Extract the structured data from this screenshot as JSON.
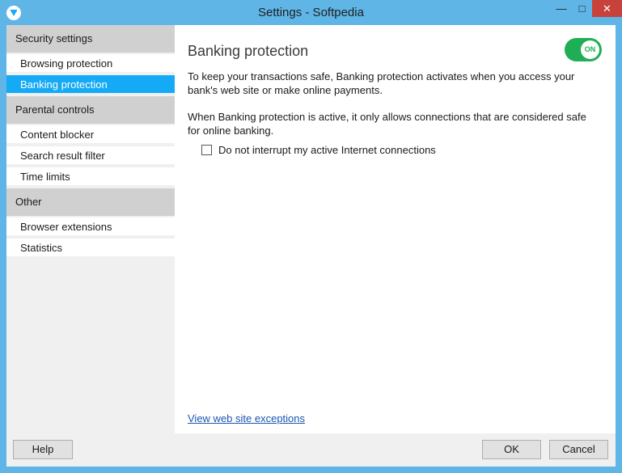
{
  "window": {
    "title": "Settings - Softpedia",
    "icon": "shield-icon",
    "controls": {
      "minimize": "minimize-icon",
      "maximize": "maximize-icon",
      "close": "close-icon"
    }
  },
  "sidebar": {
    "sections": [
      {
        "header": "Security settings",
        "items": [
          "Browsing protection",
          "Banking protection"
        ]
      },
      {
        "header": "Parental controls",
        "items": [
          "Content blocker",
          "Search result filter",
          "Time limits"
        ]
      },
      {
        "header": "Other",
        "items": [
          "Browser extensions",
          "Statistics"
        ]
      }
    ],
    "selected": "Banking protection"
  },
  "main": {
    "title": "Banking protection",
    "toggle": {
      "label": "ON",
      "state": "on"
    },
    "paragraph1": "To keep your transactions safe, Banking protection activates when you access your bank's web site or make online payments.",
    "paragraph2": "When Banking protection is active, it only allows connections that are considered safe for online banking.",
    "checkbox": {
      "label": "Do not interrupt my active Internet connections",
      "checked": false
    },
    "link": "View web site exceptions"
  },
  "footer": {
    "help": "Help",
    "ok": "OK",
    "cancel": "Cancel"
  },
  "colors": {
    "titlebar": "#5fb5e6",
    "accent_selected": "#14aaf5",
    "toggle_on": "#1fae55",
    "close_button": "#c7423a",
    "link": "#1a56b0"
  }
}
